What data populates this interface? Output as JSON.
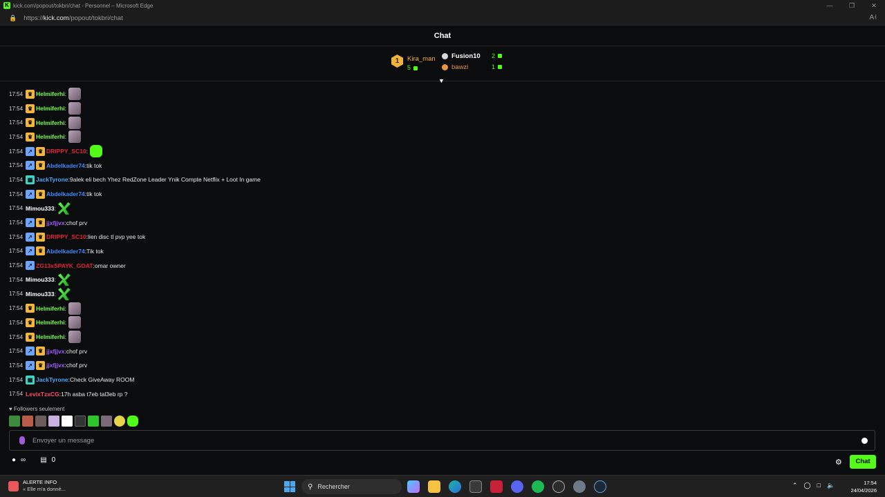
{
  "window": {
    "title": "kick.com/popout/tokbri/chat - Personnel – Microsoft Edge",
    "url_prefix": "https://",
    "url_host": "kick.com",
    "url_path": "/popout/tokbri/chat"
  },
  "chat": {
    "header": "Chat",
    "leaderboard": {
      "first": {
        "rank": "1",
        "name": "Kira_man",
        "count": "5"
      },
      "others": [
        {
          "name": "Fusion10",
          "count": "2"
        },
        {
          "name": "bawzi",
          "count": "1"
        }
      ]
    },
    "messages": [
      {
        "time": "17:54",
        "badges": [
          "sub"
        ],
        "user": "Helmiferhi",
        "color": "#7cff4f",
        "text": "",
        "emote": "face"
      },
      {
        "time": "17:54",
        "badges": [
          "sub"
        ],
        "user": "Helmiferhi",
        "color": "#7cff4f",
        "text": "",
        "emote": "face"
      },
      {
        "time": "17:54",
        "badges": [
          "sub"
        ],
        "user": "Helmiferhi",
        "color": "#7cff4f",
        "text": "",
        "emote": "face"
      },
      {
        "time": "17:54",
        "badges": [
          "sub"
        ],
        "user": "Helmiferhi",
        "color": "#7cff4f",
        "text": "",
        "emote": "face"
      },
      {
        "time": "17:54",
        "badges": [
          "vip",
          "sub"
        ],
        "user": "DRIPPY_SC10",
        "color": "#e0283b",
        "text": "",
        "emote": "blob"
      },
      {
        "time": "17:54",
        "badges": [
          "vip",
          "sub"
        ],
        "user": "Abdelkader74",
        "color": "#3f8cff",
        "text": "tik tok",
        "emote": ""
      },
      {
        "time": "17:54",
        "badges": [
          "teal"
        ],
        "user": "JackTyrone",
        "color": "#4aa8ff",
        "text": "9alek eli bech Yhez RedZone Leader Ynik Compte Netflix + Loot In game",
        "emote": ""
      },
      {
        "time": "17:54",
        "badges": [
          "vip",
          "sub"
        ],
        "user": "Abdelkader74",
        "color": "#3f8cff",
        "text": "tik tok",
        "emote": ""
      },
      {
        "time": "17:54",
        "badges": [],
        "user": "Mimou333",
        "color": "#ffffff",
        "text": "",
        "emote": "mark"
      },
      {
        "time": "17:54",
        "badges": [
          "vip",
          "sub"
        ],
        "user": "jjxfjjvx",
        "color": "#a45cff",
        "text": "chof prv",
        "emote": ""
      },
      {
        "time": "17:54",
        "badges": [
          "vip",
          "sub"
        ],
        "user": "DRIPPY_SC10",
        "color": "#e0283b",
        "text": "lien disc tl pvp yee tok",
        "emote": ""
      },
      {
        "time": "17:54",
        "badges": [
          "vip",
          "sub"
        ],
        "user": "Abdelkader74",
        "color": "#3f8cff",
        "text": "Tik tok",
        "emote": ""
      },
      {
        "time": "17:54",
        "badges": [
          "vip"
        ],
        "user": "ZG13xSPAYK_GOAT",
        "color": "#e0283b",
        "text": "omar owner",
        "emote": ""
      },
      {
        "time": "17:54",
        "badges": [],
        "user": "Mimou333",
        "color": "#ffffff",
        "text": "",
        "emote": "mark"
      },
      {
        "time": "17:54",
        "badges": [],
        "user": "Mimou333",
        "color": "#ffffff",
        "text": "",
        "emote": "mark"
      },
      {
        "time": "17:54",
        "badges": [
          "sub"
        ],
        "user": "Helmiferhi",
        "color": "#7cff4f",
        "text": "",
        "emote": "face"
      },
      {
        "time": "17:54",
        "badges": [
          "sub"
        ],
        "user": "Helmiferhi",
        "color": "#7cff4f",
        "text": "",
        "emote": "face"
      },
      {
        "time": "17:54",
        "badges": [
          "sub"
        ],
        "user": "Helmiferhi",
        "color": "#7cff4f",
        "text": "",
        "emote": "face"
      },
      {
        "time": "17:54",
        "badges": [
          "vip",
          "sub"
        ],
        "user": "jjxfjjvx",
        "color": "#a45cff",
        "text": "chof prv",
        "emote": ""
      },
      {
        "time": "17:54",
        "badges": [
          "vip",
          "sub"
        ],
        "user": "jjxfjjvx",
        "color": "#a45cff",
        "text": "chof prv",
        "emote": ""
      },
      {
        "time": "17:54",
        "badges": [
          "teal"
        ],
        "user": "JackTyrone",
        "color": "#4aa8ff",
        "text": "Check GiveAway ROOM",
        "emote": ""
      },
      {
        "time": "17:54",
        "badges": [],
        "user": "LevixTzxCG",
        "color": "#ff4d6d",
        "text": "17h asba t7eb tal3eb rp ?",
        "emote": ""
      }
    ],
    "followers_label": "Followers seulement",
    "input_placeholder": "Envoyer un message",
    "infinity": "∞",
    "gift_count": "0",
    "send_label": "Chat"
  },
  "taskbar": {
    "news_title": "ALERTE INFO",
    "news_sub": "« Elle m'a donné...",
    "search_label": "Rechercher",
    "time": "17:54",
    "date": "24/04/2026"
  },
  "colors": {
    "accent": "#53fc18",
    "gold": "#f2b33d",
    "bronze": "#e8953f"
  }
}
